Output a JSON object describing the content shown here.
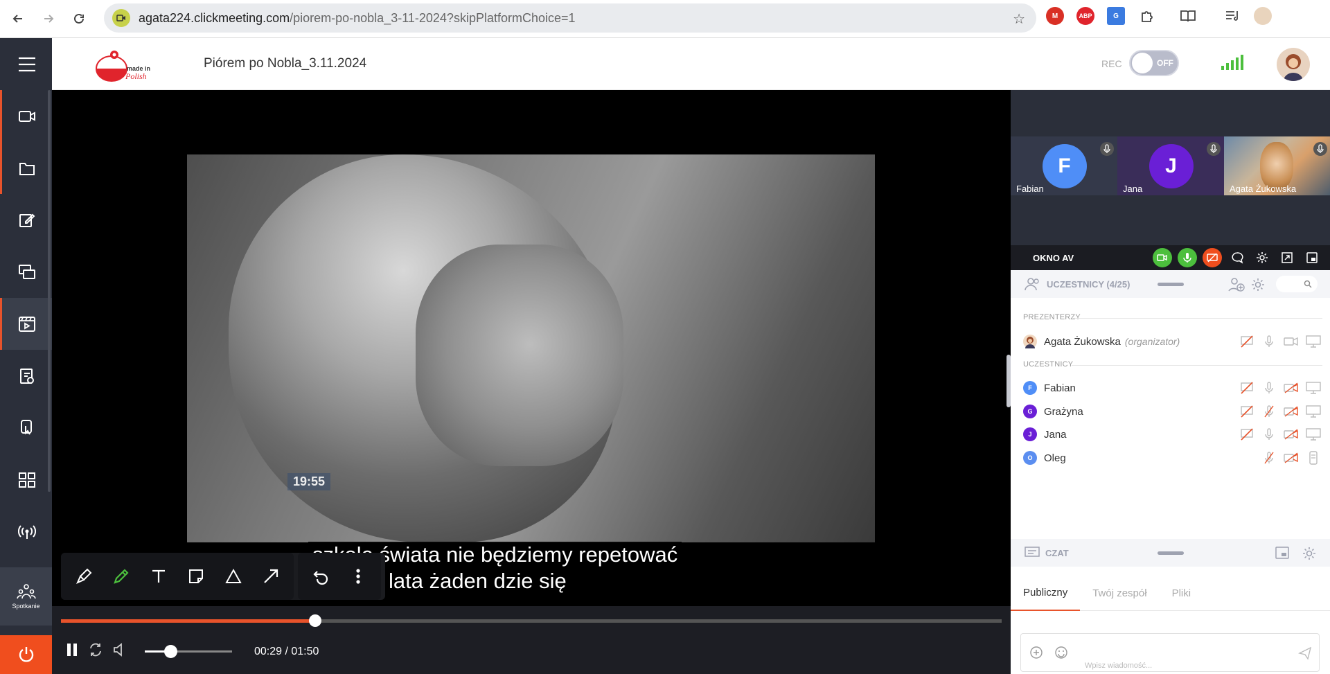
{
  "browser": {
    "url_domain": "agata224.clickmeeting.com",
    "url_path": "/piorem-po-nobla_3-11-2024?skipPlatformChoice=1"
  },
  "header": {
    "logo_text": "made in Polish",
    "title": "Piórem po Nobla_3.11.2024",
    "rec_label": "REC",
    "rec_state": "OFF"
  },
  "sidebar": {
    "spotkanie_label": "Spotkanie"
  },
  "video": {
    "stamp": "19:55",
    "subtitle_line1": "szkole świata nie będziemy repetować",
    "subtitle_line2": "ani lata żaden dzie się"
  },
  "player": {
    "progress": 0.27,
    "volume": 0.29,
    "time": "00:29 / 01:50"
  },
  "av_tiles": [
    {
      "initial": "F",
      "name": "Fabian",
      "color": "#4f8ef7",
      "bg": "#34394a"
    },
    {
      "initial": "J",
      "name": "Jana",
      "color": "#6a1fd6",
      "bg": "#3a2d59"
    },
    {
      "initial": "",
      "name": "Agata Żukowska",
      "color": "#c9b49a",
      "bg": "#8a7f75"
    }
  ],
  "av_bar": {
    "label": "OKNO AV"
  },
  "participants": {
    "title": "UCZESTNICY (4/25)",
    "presenters_label": "PREZENTERZY",
    "attendees_label": "UCZESTNICY",
    "presenter": {
      "name": "Agata Żukowska",
      "role": "(organizator)"
    },
    "attendees": [
      {
        "initial": "F",
        "name": "Fabian",
        "color": "#4f8ef7"
      },
      {
        "initial": "G",
        "name": "Grażyna",
        "color": "#6a1fd6"
      },
      {
        "initial": "J",
        "name": "Jana",
        "color": "#6a1fd6"
      },
      {
        "initial": "O",
        "name": "Oleg",
        "color": "#5b8ef0"
      }
    ]
  },
  "chat": {
    "title": "CZAT",
    "tabs": [
      "Publiczny",
      "Twój zespół",
      "Pliki"
    ],
    "placeholder": "Wpisz wiadomość..."
  },
  "colors": {
    "accent": "#e8532b",
    "sidebar": "#2b2f3a",
    "green": "#4cbf3d"
  }
}
